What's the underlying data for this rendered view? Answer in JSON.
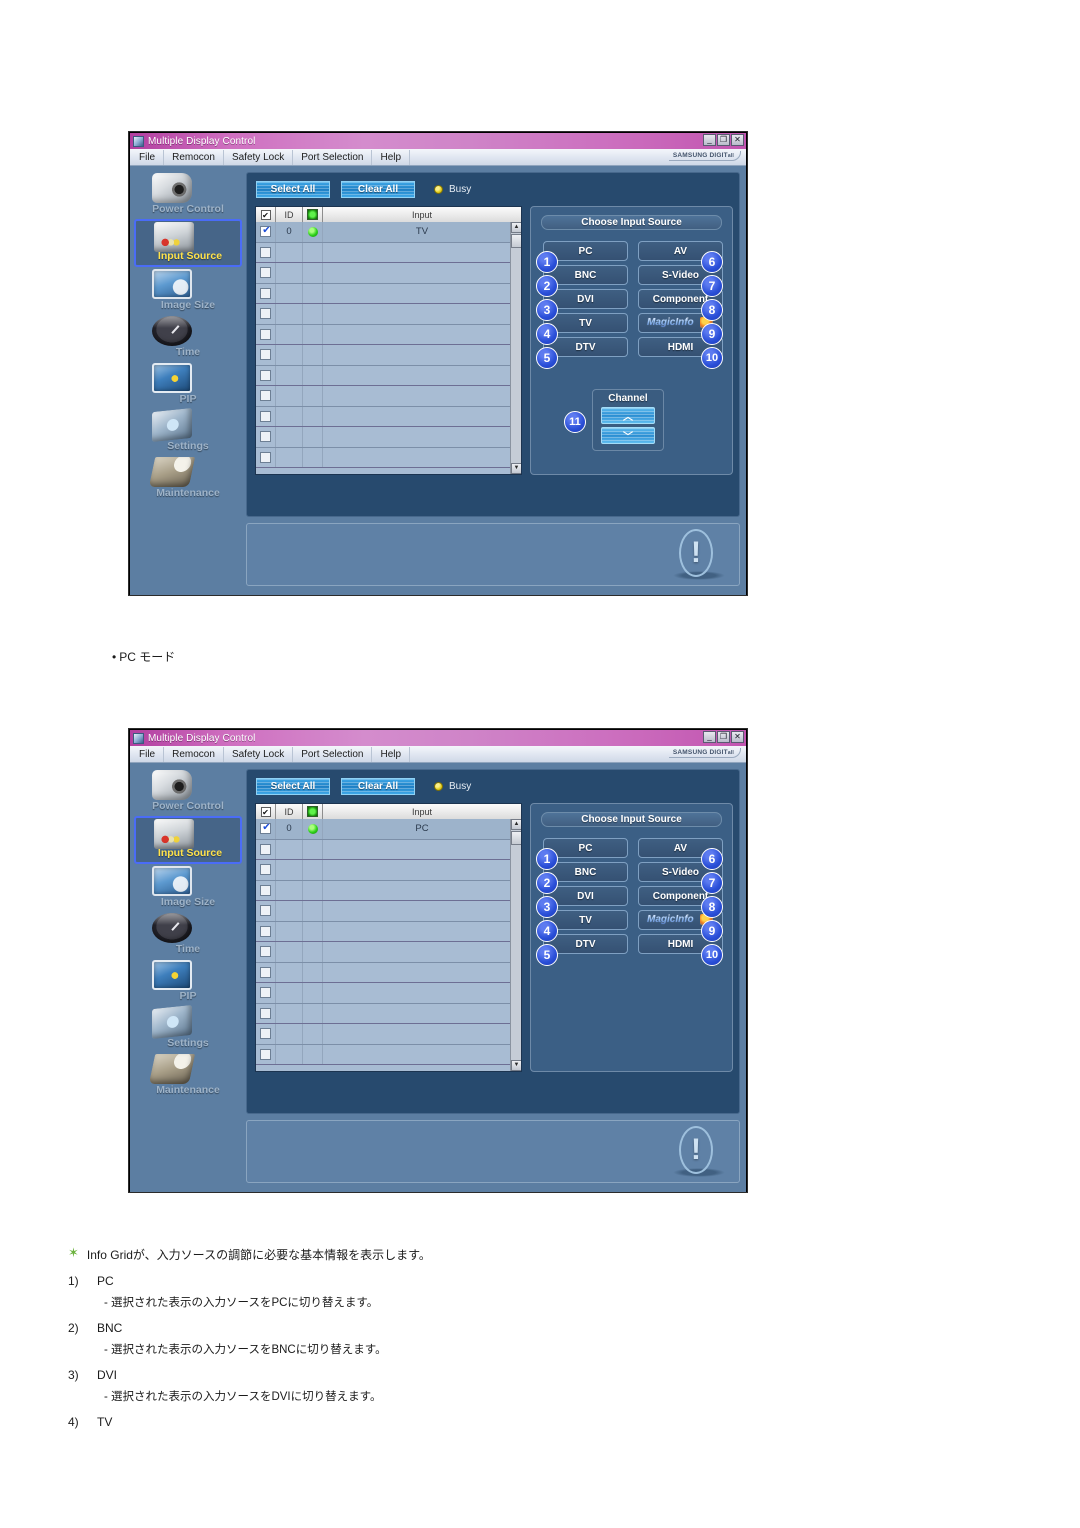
{
  "window": {
    "title": "Multiple Display Control",
    "title_icon": "app-icon",
    "buttons": {
      "minimize": "_",
      "maximize": "❐",
      "close": "✕"
    },
    "menu": [
      "File",
      "Remocon",
      "Safety Lock",
      "Port Selection",
      "Help"
    ],
    "brand": "SAMSUNG DIGIT",
    "brand_sub": "all"
  },
  "sidebar": {
    "items": [
      {
        "label": "Power Control",
        "icon": "power-control-icon",
        "active": false
      },
      {
        "label": "Input Source",
        "icon": "input-source-icon",
        "active": true
      },
      {
        "label": "Image Size",
        "icon": "image-size-icon",
        "active": false
      },
      {
        "label": "Time",
        "icon": "time-icon",
        "active": false
      },
      {
        "label": "PIP",
        "icon": "pip-icon",
        "active": false
      },
      {
        "label": "Settings",
        "icon": "settings-icon",
        "active": false
      },
      {
        "label": "Maintenance",
        "icon": "maintenance-icon",
        "active": false
      }
    ]
  },
  "toolbar": {
    "select_all": "Select All",
    "clear_all": "Clear All",
    "busy_label": "Busy",
    "busy_led_color": "#e4cf1e"
  },
  "grid": {
    "headers": [
      "",
      "ID",
      "",
      "Input"
    ],
    "header_checkbox": "✔",
    "header_status_icon": "power-led-icon",
    "rows_total": 12,
    "row_0": {
      "checked": true,
      "id": "0",
      "status": "on",
      "input_tv": "TV",
      "input_pc": "PC"
    },
    "scrollbar": {
      "up": "▲",
      "down": "▼"
    }
  },
  "choose_input_source": {
    "title": "Choose Input Source",
    "buttons": [
      {
        "n": "1",
        "label": "PC"
      },
      {
        "n": "6",
        "label": "AV"
      },
      {
        "n": "2",
        "label": "BNC"
      },
      {
        "n": "7",
        "label": "S-Video"
      },
      {
        "n": "3",
        "label": "DVI"
      },
      {
        "n": "8",
        "label": "Component"
      },
      {
        "n": "4",
        "label": "TV"
      },
      {
        "n": "9",
        "label": "MagicInfo"
      },
      {
        "n": "5",
        "label": "DTV"
      },
      {
        "n": "10",
        "label": "HDMI"
      }
    ],
    "channel": {
      "number": "11",
      "title": "Channel",
      "up": "︿",
      "down": "﹀"
    }
  },
  "info_panel": {
    "icon": "exclamation-icon",
    "glyph": "!"
  },
  "mid_note": {
    "bullet": "•",
    "text": "PC モード"
  },
  "notes": {
    "star": "Info Gridが、入力ソースの調節に必要な基本情報を表示します。",
    "items": [
      {
        "n": "1)",
        "label": "PC",
        "desc": "-  選択された表示の入力ソースをPCに切り替えます。"
      },
      {
        "n": "2)",
        "label": "BNC",
        "desc": "-  選択された表示の入力ソースをBNCに切り替えます。"
      },
      {
        "n": "3)",
        "label": "DVI",
        "desc": "-  選択された表示の入力ソースをDVIに切り替えます。"
      },
      {
        "n": "4)",
        "label": "TV",
        "desc": ""
      }
    ]
  },
  "colors": {
    "window_bg": "#5c7ea2",
    "panel_bg": "#274a6e",
    "titlebar": "#cf7cc5",
    "accent_blue": "#2a4fd8",
    "active_label": "#ffe24a"
  }
}
